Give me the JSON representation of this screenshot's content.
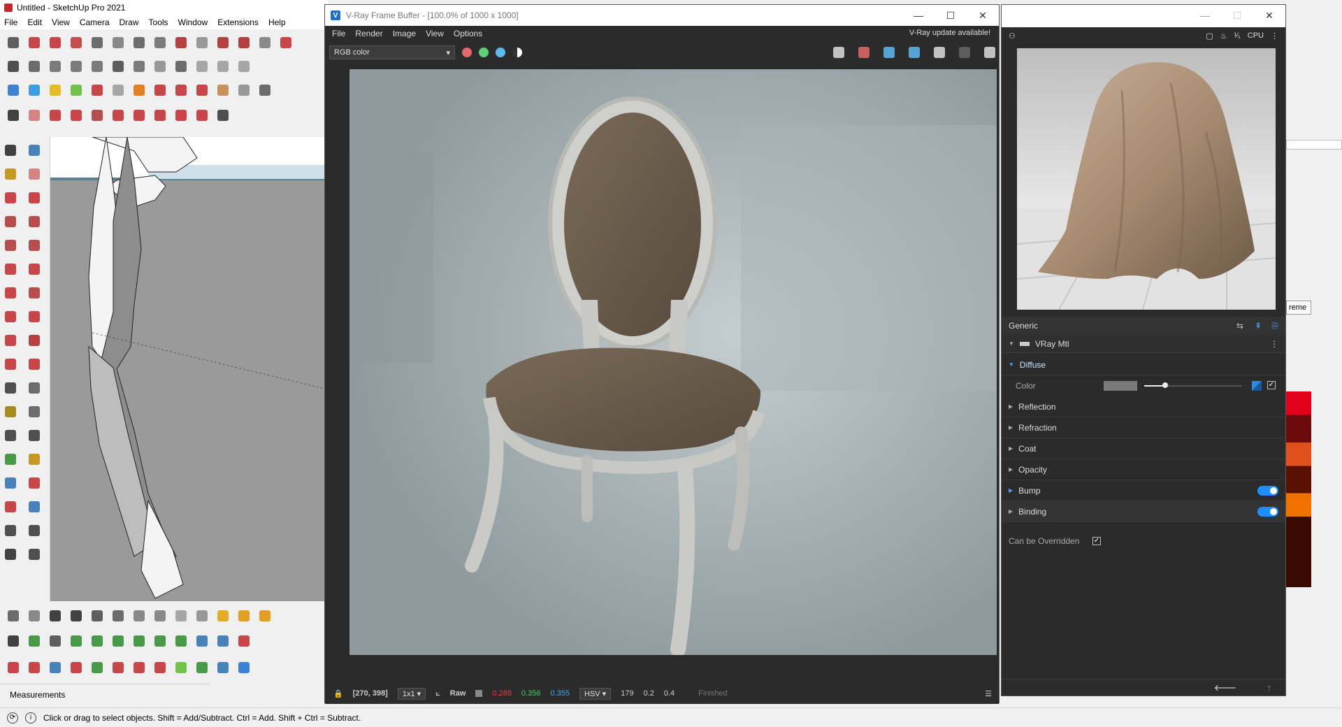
{
  "sketchup": {
    "title": "Untitled - SketchUp Pro 2021",
    "menu": [
      "File",
      "Edit",
      "View",
      "Camera",
      "Draw",
      "Tools",
      "Window",
      "Extensions",
      "Help"
    ],
    "measurements_label": "Measurements",
    "status_text": "Click or drag to select objects. Shift = Add/Subtract. Ctrl = Add. Shift + Ctrl = Subtract."
  },
  "vfb": {
    "title": "V-Ray Frame Buffer - [100.0% of 1000 x 1000]",
    "menu": [
      "File",
      "Render",
      "Image",
      "View",
      "Options"
    ],
    "update_notice": "V-Ray update available!",
    "channel": "RGB color",
    "status": {
      "coords": "[270, 398]",
      "sampling": "1x1",
      "mode": "Raw",
      "r": "0.288",
      "g": "0.356",
      "b": "0.355",
      "color_space": "HSV",
      "h": "179",
      "s": "0.2",
      "v": "0.4",
      "state": "Finished"
    }
  },
  "material_editor": {
    "cpu_label": "CPU",
    "panel_label": "Generic",
    "material_type": "VRay Mtl",
    "diffuse": {
      "label": "Diffuse",
      "color_label": "Color",
      "color_value": "#7a7a7a"
    },
    "sections": [
      "Reflection",
      "Refraction",
      "Coat",
      "Opacity",
      "Bump",
      "Binding"
    ],
    "override_label": "Can be Overridden",
    "side_label": "reme"
  },
  "colors": {
    "accent": "#1f8fff",
    "dark_bg": "#2b2b2b",
    "sketchup_red": "#c1272d"
  }
}
